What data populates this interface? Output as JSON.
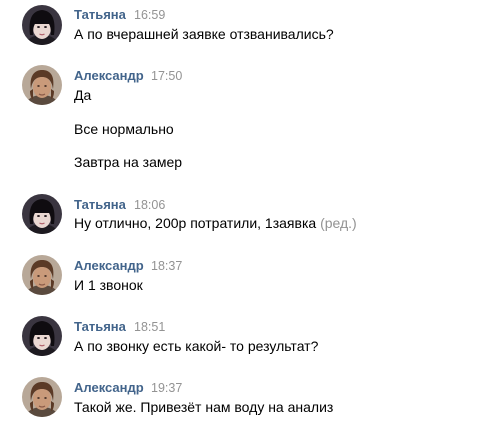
{
  "messages": [
    {
      "author": "Татьяна",
      "avatar_icon": "female-avatar",
      "time": "16:59",
      "lines": [
        "А по вчерашней заявке отзванивались?"
      ]
    },
    {
      "author": "Александр",
      "avatar_icon": "male-avatar",
      "time": "17:50",
      "lines": [
        "Да",
        "Все нормально",
        "Завтра на замер"
      ]
    },
    {
      "author": "Татьяна",
      "avatar_icon": "female-avatar",
      "time": "18:06",
      "lines": [
        "Ну отлично, 200р потратили, 1заявка"
      ],
      "edited_label": "(ред.)"
    },
    {
      "author": "Александр",
      "avatar_icon": "male-avatar",
      "time": "18:37",
      "lines": [
        "И 1 звонок"
      ]
    },
    {
      "author": "Татьяна",
      "avatar_icon": "female-avatar",
      "time": "18:51",
      "lines": [
        "А по звонку есть какой- то результат?"
      ]
    },
    {
      "author": "Александр",
      "avatar_icon": "male-avatar",
      "time": "19:37",
      "lines": [
        "Такой же. Привезёт нам воду на анализ"
      ]
    }
  ],
  "colors": {
    "author": "#42648b",
    "timestamp": "#939393",
    "text": "#000000",
    "background": "#ffffff"
  }
}
